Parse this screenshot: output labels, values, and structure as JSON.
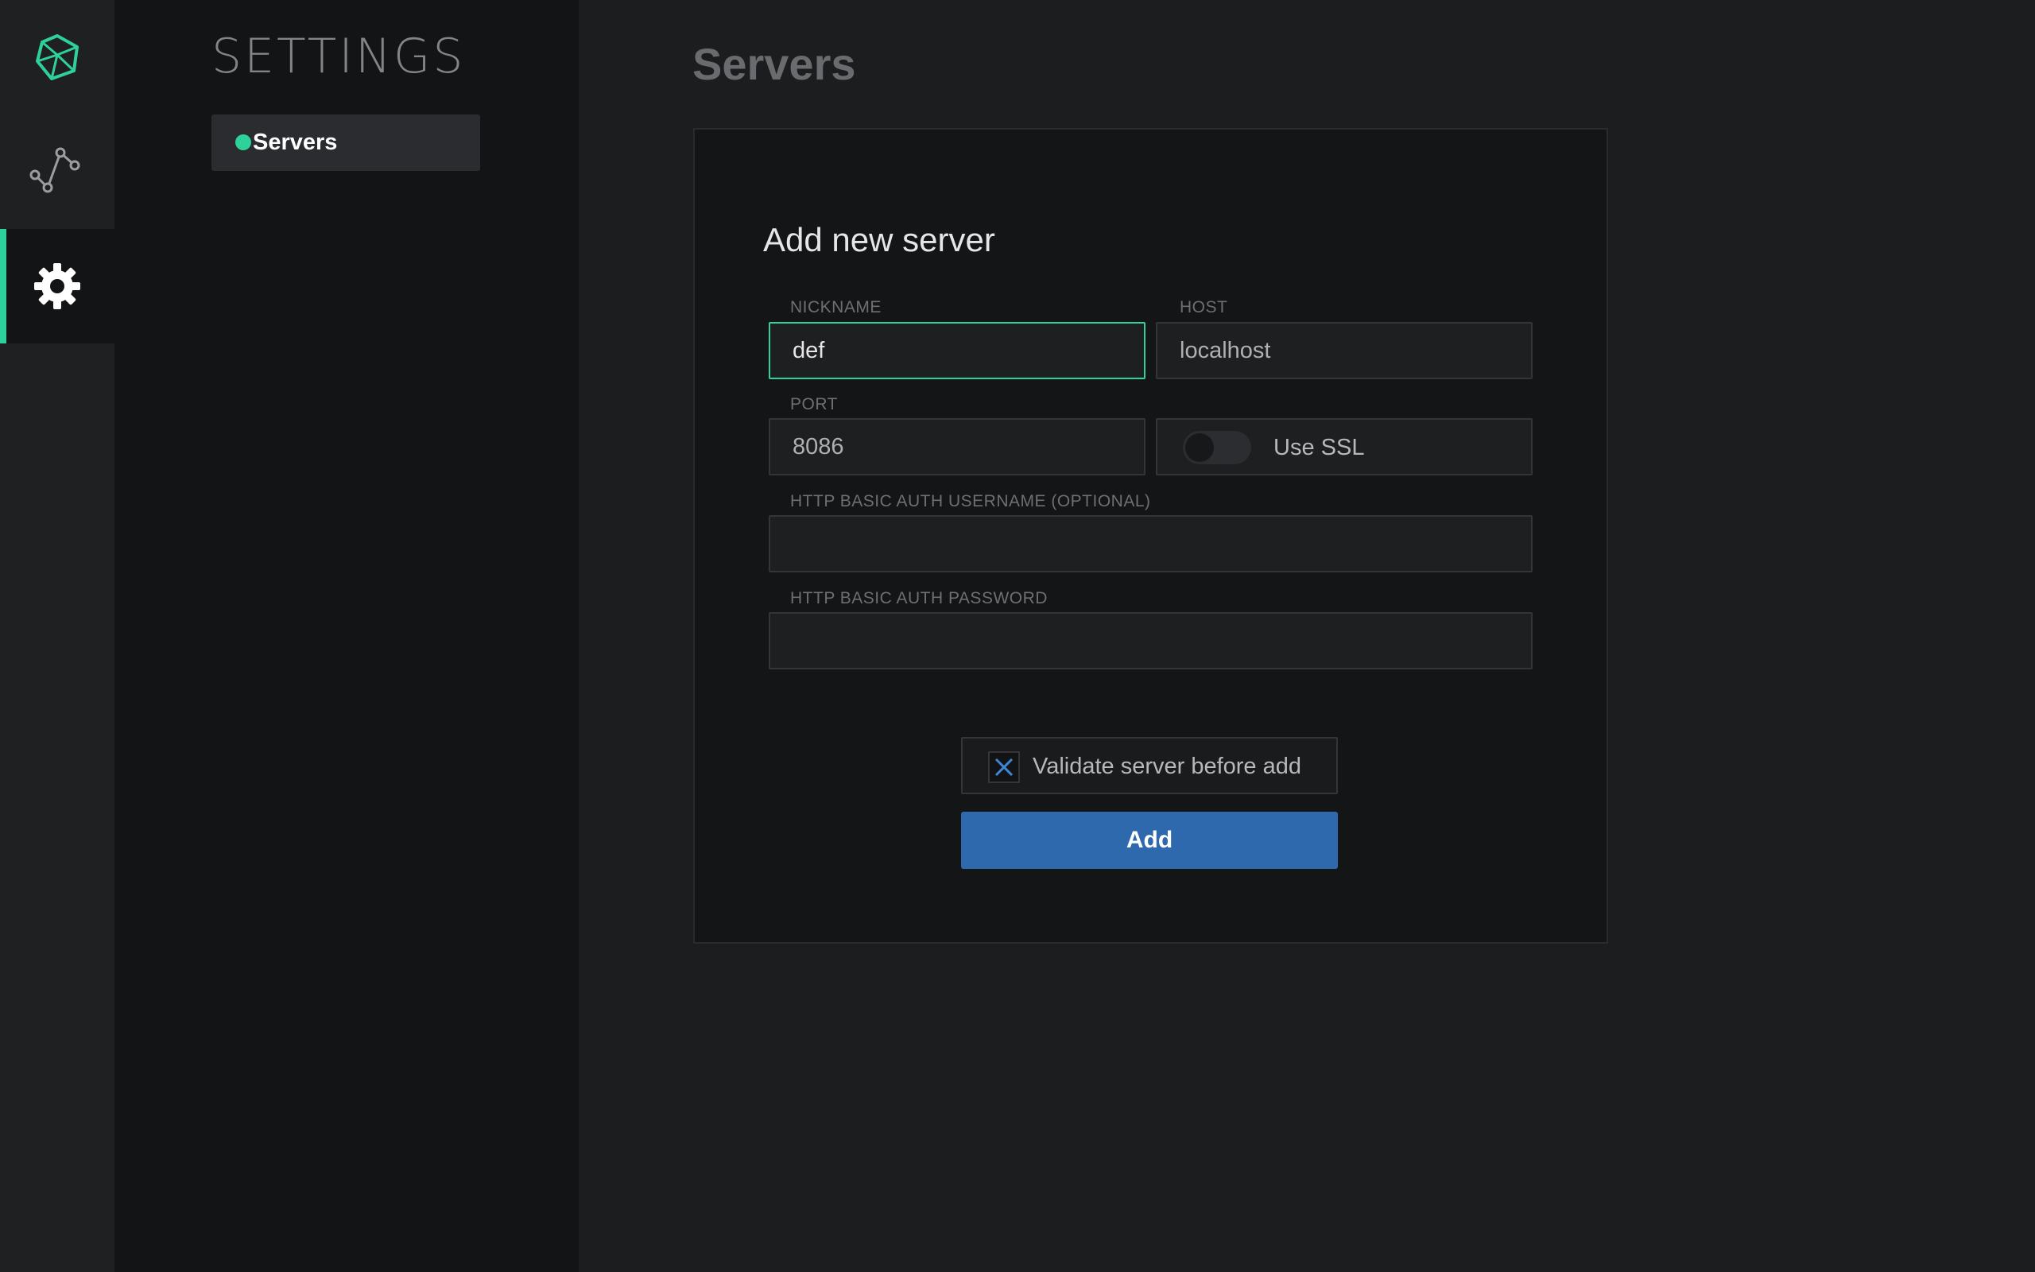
{
  "app": {
    "rail": {
      "items": [
        {
          "name": "logo",
          "icon": "logo-icon"
        },
        {
          "name": "graphs",
          "icon": "graph-icon"
        },
        {
          "name": "settings",
          "icon": "gear-icon",
          "active": true
        }
      ]
    }
  },
  "sidebar": {
    "title": "SETTINGS",
    "items": [
      {
        "label": "Servers",
        "active": true,
        "status_color": "#2fd19a"
      }
    ]
  },
  "main": {
    "title": "Servers",
    "form": {
      "heading": "Add new server",
      "nickname": {
        "label": "NICKNAME",
        "value": "def"
      },
      "host": {
        "label": "HOST",
        "value": "localhost"
      },
      "port": {
        "label": "PORT",
        "value": "8086"
      },
      "ssl": {
        "label": "Use SSL",
        "enabled": false
      },
      "username": {
        "label": "HTTP BASIC AUTH USERNAME (OPTIONAL)",
        "value": ""
      },
      "password": {
        "label": "HTTP BASIC AUTH PASSWORD",
        "value": ""
      },
      "validate": {
        "label": "Validate server before add",
        "checked": true
      },
      "submit_label": "Add"
    }
  },
  "colors": {
    "accent": "#2fd19a",
    "primary_button": "#2f69ad",
    "background": "#1c1d1f",
    "panel": "#141517"
  }
}
